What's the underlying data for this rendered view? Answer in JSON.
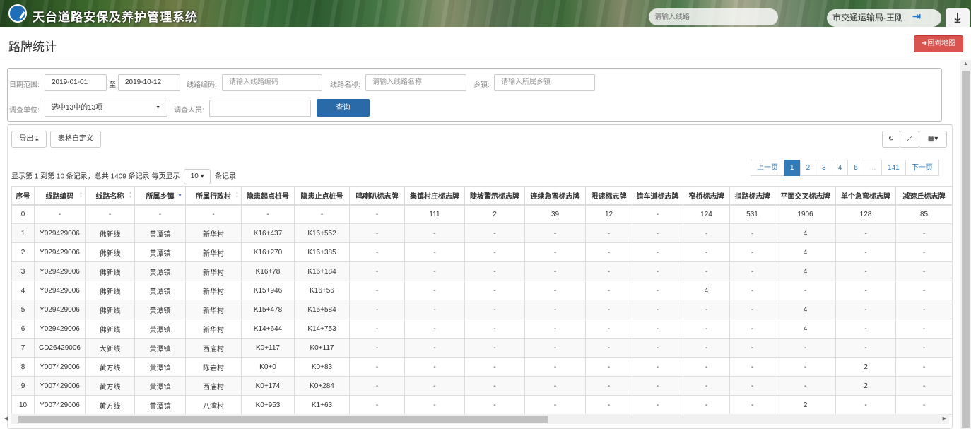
{
  "app": {
    "title": "天台道路安保及养护管理系统",
    "route_search_placeholder": "请输入线路",
    "user": "市交通运输局-王刚"
  },
  "header": {
    "title": "路牌统计",
    "back_label": "回到地图"
  },
  "filters": {
    "date_label": "日期范围:",
    "date_from": "2019-01-01",
    "date_sep": "至",
    "date_to": "2019-10-12",
    "code_label": "线路编码:",
    "code_placeholder": "请输入线路编码",
    "name_label": "线路名称:",
    "name_placeholder": "请输入线路名称",
    "town_label": "乡镇:",
    "town_placeholder": "请输入所属乡镇",
    "unit_label": "调查单位:",
    "unit_value": "选中13中的13项",
    "person_label": "调查人员:",
    "person_value": "",
    "query_label": "查询"
  },
  "toolbar": {
    "export_label": "导出",
    "custom_label": "表格自定义"
  },
  "records": {
    "prefix": "显示第 1 到第 10 条记录，总共 1409 条记录  每页显示",
    "page_size": "10",
    "suffix": "条记录"
  },
  "pager": {
    "prev": "上一页",
    "pages": [
      "1",
      "2",
      "3",
      "4",
      "5",
      "...",
      "141"
    ],
    "next": "下一页"
  },
  "table": {
    "columns": [
      "序号",
      "线路编码",
      "线路名称",
      "所属乡镇",
      "所属行政村",
      "隐患起点桩号",
      "隐患止点桩号",
      "鸣喇叭标志牌",
      "集镇村庄标志牌",
      "陡坡警示标志牌",
      "连续急弯标志牌",
      "限速标志牌",
      "错车道标志牌",
      "窄桥标志牌",
      "指路标志牌",
      "平面交叉标志牌",
      "单个急弯标志牌",
      "减速丘标志牌"
    ],
    "rows": [
      [
        "0",
        "-",
        "-",
        "-",
        "-",
        "-",
        "-",
        "-",
        "111",
        "2",
        "39",
        "12",
        "-",
        "124",
        "531",
        "1906",
        "128",
        "85"
      ],
      [
        "1",
        "Y029429006",
        "佛新线",
        "黄潭镇",
        "新华村",
        "K16+437",
        "K16+552",
        "-",
        "-",
        "-",
        "-",
        "-",
        "-",
        "-",
        "-",
        "4",
        "-",
        "-"
      ],
      [
        "2",
        "Y029429006",
        "佛新线",
        "黄潭镇",
        "新华村",
        "K16+270",
        "K16+385",
        "-",
        "-",
        "-",
        "-",
        "-",
        "-",
        "-",
        "-",
        "4",
        "-",
        "-"
      ],
      [
        "3",
        "Y029429006",
        "佛新线",
        "黄潭镇",
        "新华村",
        "K16+78",
        "K16+184",
        "-",
        "-",
        "-",
        "-",
        "-",
        "-",
        "-",
        "-",
        "4",
        "-",
        "-"
      ],
      [
        "4",
        "Y029429006",
        "佛新线",
        "黄潭镇",
        "新华村",
        "K15+946",
        "K16+56",
        "-",
        "-",
        "-",
        "-",
        "-",
        "-",
        "4",
        "-",
        "-",
        "-",
        "-"
      ],
      [
        "5",
        "Y029429006",
        "佛新线",
        "黄潭镇",
        "新华村",
        "K15+478",
        "K15+584",
        "-",
        "-",
        "-",
        "-",
        "-",
        "-",
        "-",
        "-",
        "4",
        "-",
        "-"
      ],
      [
        "6",
        "Y029429006",
        "佛新线",
        "黄潭镇",
        "新华村",
        "K14+644",
        "K14+753",
        "-",
        "-",
        "-",
        "-",
        "-",
        "-",
        "-",
        "-",
        "4",
        "-",
        "-"
      ],
      [
        "7",
        "CD26429006",
        "大新线",
        "黄潭镇",
        "西庙村",
        "K0+117",
        "K0+117",
        "-",
        "-",
        "-",
        "-",
        "-",
        "-",
        "-",
        "-",
        "-",
        "-",
        "-"
      ],
      [
        "8",
        "Y007429006",
        "黄方线",
        "黄潭镇",
        "陈岩村",
        "K0+0",
        "K0+83",
        "-",
        "-",
        "-",
        "-",
        "-",
        "-",
        "-",
        "-",
        "-",
        "2",
        "-"
      ],
      [
        "9",
        "Y007429006",
        "黄方线",
        "黄潭镇",
        "西庙村",
        "K0+174",
        "K0+284",
        "-",
        "-",
        "-",
        "-",
        "-",
        "-",
        "-",
        "-",
        "-",
        "2",
        "-"
      ],
      [
        "10",
        "Y007429006",
        "黄方线",
        "黄潭镇",
        "八湾村",
        "K0+953",
        "K1+63",
        "-",
        "-",
        "-",
        "-",
        "-",
        "-",
        "-",
        "-",
        "2",
        "-",
        "-"
      ]
    ]
  }
}
